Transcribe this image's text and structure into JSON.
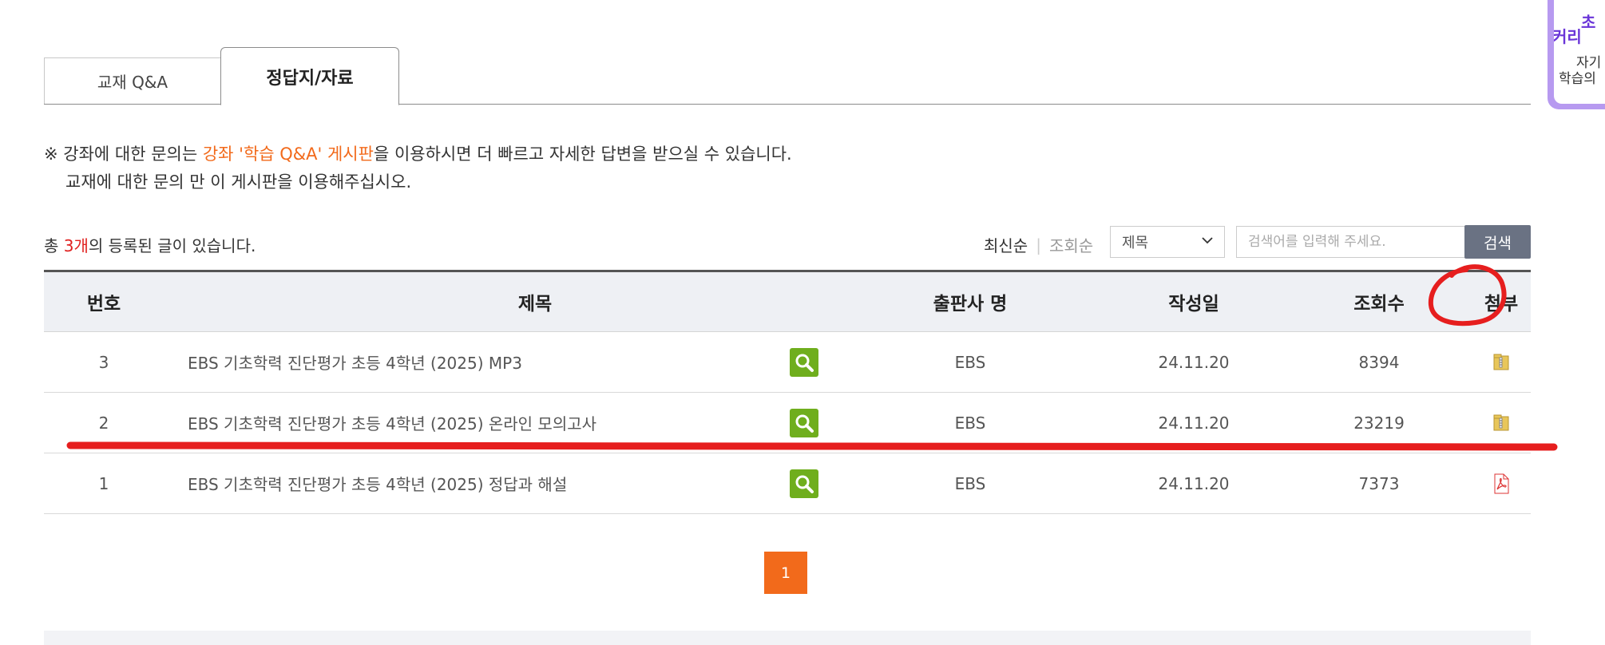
{
  "tabs": [
    {
      "label": "교재 Q&A"
    },
    {
      "label": "정답지/자료"
    }
  ],
  "notice": {
    "prefix": "※ 강좌에 대한 문의는 ",
    "accent": "강좌 '학습 Q&A' 게시판",
    "suffix": "을 이용하시면 더 빠르고 자세한 답변을 받으실 수 있습니다.",
    "line2": "교재에 대한 문의 만 이 게시판을 이용해주십시오."
  },
  "count": {
    "prefix": "총 ",
    "num": "3개",
    "suffix": "의 등록된 글이 있습니다."
  },
  "sort": {
    "latest": "최신순",
    "views": "조회순"
  },
  "search": {
    "select_value": "제목",
    "placeholder": "검색어를 입력해 주세요.",
    "button": "검색"
  },
  "table": {
    "headers": {
      "no": "번호",
      "title": "제목",
      "publisher": "출판사 명",
      "date": "작성일",
      "views": "조회수",
      "attach": "첨부"
    },
    "rows": [
      {
        "no": "3",
        "title": "EBS 기초학력 진단평가 초등 4학년 (2025) MP3",
        "publisher": "EBS",
        "date": "24.11.20",
        "views": "8394",
        "attach_icon": "zip-file-icon"
      },
      {
        "no": "2",
        "title": "EBS 기초학력 진단평가 초등 4학년 (2025) 온라인 모의고사",
        "publisher": "EBS",
        "date": "24.11.20",
        "views": "23219",
        "attach_icon": "zip-file-icon"
      },
      {
        "no": "1",
        "title": "EBS 기초학력 진단평가 초등 4학년 (2025) 정답과 해설",
        "publisher": "EBS",
        "date": "24.11.20",
        "views": "7373",
        "attach_icon": "pdf-file-icon"
      }
    ]
  },
  "pagination": {
    "current": "1"
  },
  "side_banner": {
    "line1": "초",
    "line2": "커리",
    "line3": "자기",
    "line4": "학습의"
  },
  "colors": {
    "accent": "#f26a1b",
    "count": "#e0201f",
    "search_button": "#6a7283",
    "preview_icon": "#6fae1d",
    "annotation": "#e61e1e",
    "banner": "#b79af0"
  }
}
